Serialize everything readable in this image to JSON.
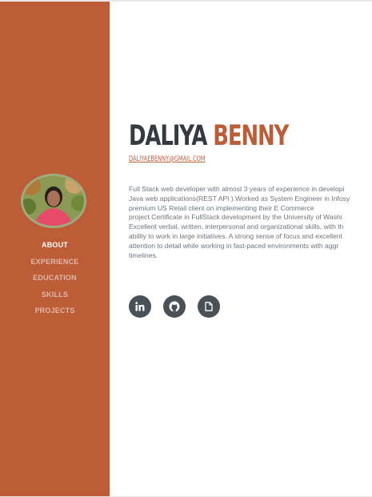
{
  "profile": {
    "first_name": "DALIYA",
    "last_name": "BENNY",
    "email": "DALIYAEBENNY@GMAIL.COM",
    "bio": "Full Stack web developer with almost 3 years of experience in developi\nJava web applications(REST API ).Worked as System Engineer in Infosy\npremium US Retail client on implementing their E Commerce\nproject.Certificate in FullStack development by the University of Washi\nExcellent verbal, written, interpersonal and organizational skills, with th\nability to work in large initiatives. A strong sense of focus and excellent\nattention to detail while working in fast-paced environments with aggr\ntimelines."
  },
  "nav": {
    "items": [
      {
        "label": "ABOUT",
        "active": true
      },
      {
        "label": "EXPERIENCE",
        "active": false
      },
      {
        "label": "EDUCATION",
        "active": false
      },
      {
        "label": "SKILLS",
        "active": false
      },
      {
        "label": "PROJECTS",
        "active": false
      }
    ]
  },
  "social": [
    {
      "icon": "linkedin-icon"
    },
    {
      "icon": "github-icon"
    },
    {
      "icon": "resume-file-icon"
    }
  ],
  "colors": {
    "accent": "#bd5d38",
    "heading": "#343a40",
    "text": "#6c757d",
    "social_bg": "#495057"
  }
}
